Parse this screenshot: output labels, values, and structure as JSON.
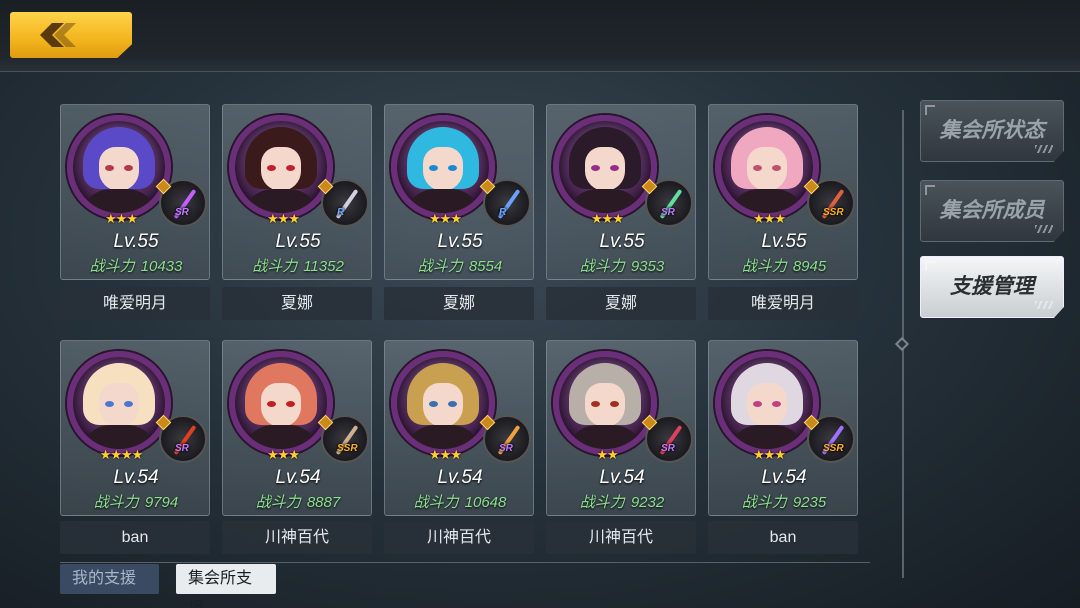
{
  "header": {
    "back_icon": "chevron-left-icon",
    "accent": "#f2b51e"
  },
  "cards": [
    {
      "level": "Lv.55",
      "power_label": "战斗力",
      "power": "10433",
      "owner": "唯爱明月",
      "rank": "SR",
      "stars": "★★★",
      "hair": "#5a4ac8",
      "eyes": "#b03a4a",
      "frame": "#6a2f78",
      "blade": "#c060ff"
    },
    {
      "level": "Lv.55",
      "power_label": "战斗力",
      "power": "11352",
      "owner": "夏娜",
      "rank": "R",
      "stars": "★★★",
      "hair": "#3a1a1a",
      "eyes": "#c02030",
      "frame": "#6a2f78",
      "blade": "#d0d0e0"
    },
    {
      "level": "Lv.55",
      "power_label": "战斗力",
      "power": "8554",
      "owner": "夏娜",
      "rank": "R",
      "stars": "★★★",
      "hair": "#2fb8e0",
      "eyes": "#1a8ad0",
      "frame": "#6a2f78",
      "blade": "#6aa0ff"
    },
    {
      "level": "Lv.55",
      "power_label": "战斗力",
      "power": "9353",
      "owner": "夏娜",
      "rank": "SR",
      "stars": "★★★",
      "hair": "#2a1a2a",
      "eyes": "#9a2a8a",
      "frame": "#6a2f78",
      "blade": "#60e0a0"
    },
    {
      "level": "Lv.55",
      "power_label": "战斗力",
      "power": "8945",
      "owner": "唯爱明月",
      "rank": "SSR",
      "stars": "★★★",
      "hair": "#f0a8c0",
      "eyes": "#c05070",
      "frame": "#6a2f78",
      "blade": "#e06040"
    },
    {
      "level": "Lv.54",
      "power_label": "战斗力",
      "power": "9794",
      "owner": "ban",
      "rank": "SR",
      "stars": "★★★★",
      "hair": "#f6e0c0",
      "eyes": "#4a78d0",
      "frame": "#6a2f78",
      "blade": "#e04020"
    },
    {
      "level": "Lv.54",
      "power_label": "战斗力",
      "power": "8887",
      "owner": "川神百代",
      "rank": "SSR",
      "stars": "★★★",
      "hair": "#e07860",
      "eyes": "#c02020",
      "frame": "#6a2f78",
      "blade": "#d0b090"
    },
    {
      "level": "Lv.54",
      "power_label": "战斗力",
      "power": "10648",
      "owner": "川神百代",
      "rank": "SR",
      "stars": "★★★",
      "hair": "#c8a050",
      "eyes": "#3a70b0",
      "frame": "#6a2f78",
      "blade": "#f0a040"
    },
    {
      "level": "Lv.54",
      "power_label": "战斗力",
      "power": "9232",
      "owner": "川神百代",
      "rank": "SR",
      "stars": "★★",
      "hair": "#b8b0a8",
      "eyes": "#a03020",
      "frame": "#6a2f78",
      "blade": "#e04060"
    },
    {
      "level": "Lv.54",
      "power_label": "战斗力",
      "power": "9235",
      "owner": "ban",
      "rank": "SSR",
      "stars": "★★★",
      "hair": "#e0d8e0",
      "eyes": "#c04080",
      "frame": "#6a2f78",
      "blade": "#a070ff"
    }
  ],
  "sidebar": {
    "items": [
      {
        "label": "集会所状态",
        "active": false
      },
      {
        "label": "集会所成员",
        "active": false
      },
      {
        "label": "支援管理",
        "active": true
      }
    ]
  },
  "bottom_tabs": [
    {
      "label": "我的支援",
      "active": false
    },
    {
      "label": "集会所支援",
      "active": true
    }
  ],
  "rank_colors": {
    "SR": "#c27cff",
    "R": "#6fa8ff",
    "SSR": "#ffb020"
  }
}
